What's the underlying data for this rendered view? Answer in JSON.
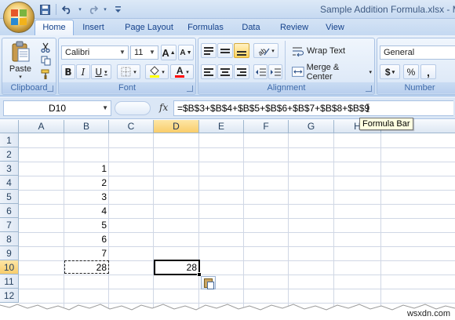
{
  "title_bar": {
    "document_title": "Sample Addition Formula.xlsx - M",
    "office_button_icon": "office-logo-icon",
    "quick_access": [
      {
        "name": "save-icon",
        "glyph": "💾"
      },
      {
        "name": "undo-icon",
        "glyph": "↶"
      },
      {
        "name": "redo-icon",
        "glyph": "↷"
      },
      {
        "name": "customize-qat-icon",
        "glyph": "▾"
      }
    ]
  },
  "tabs": [
    "Home",
    "Insert",
    "Page Layout",
    "Formulas",
    "Data",
    "Review",
    "View"
  ],
  "active_tab": "Home",
  "ribbon": {
    "clipboard": {
      "label": "Clipboard",
      "paste_label": "Paste"
    },
    "font": {
      "label": "Font",
      "font_name": "Calibri",
      "font_size": "11",
      "bold": "B",
      "italic": "I",
      "underline": "U",
      "grow": "A",
      "shrink": "A",
      "font_color_sample": "A",
      "fill_color": "#ffff00",
      "font_color": "#ff0000"
    },
    "alignment": {
      "label": "Alignment",
      "wrap_text": "Wrap Text",
      "merge_center": "Merge & Center"
    },
    "number": {
      "label": "Number",
      "format": "General",
      "currency": "$",
      "percent": "%",
      "comma": ","
    }
  },
  "formula_bar": {
    "name_box": "D10",
    "fx": "fx",
    "formula": "=$B$3+$B$4+$B$5+$B$6+$B$7+$B$8+$B$9",
    "tooltip": "Formula Bar"
  },
  "sheet": {
    "columns": [
      "A",
      "B",
      "C",
      "D",
      "E",
      "F",
      "G",
      "H"
    ],
    "rows": [
      "1",
      "2",
      "3",
      "4",
      "5",
      "6",
      "7",
      "8",
      "9",
      "10",
      "11",
      "12"
    ],
    "selected_column": "D",
    "selected_row": "10",
    "cells": {
      "B3": "1",
      "B4": "2",
      "B5": "3",
      "B6": "4",
      "B7": "5",
      "B8": "6",
      "B9": "7",
      "B10": "28",
      "D10": "28"
    }
  },
  "watermark": "wsxdn.com"
}
